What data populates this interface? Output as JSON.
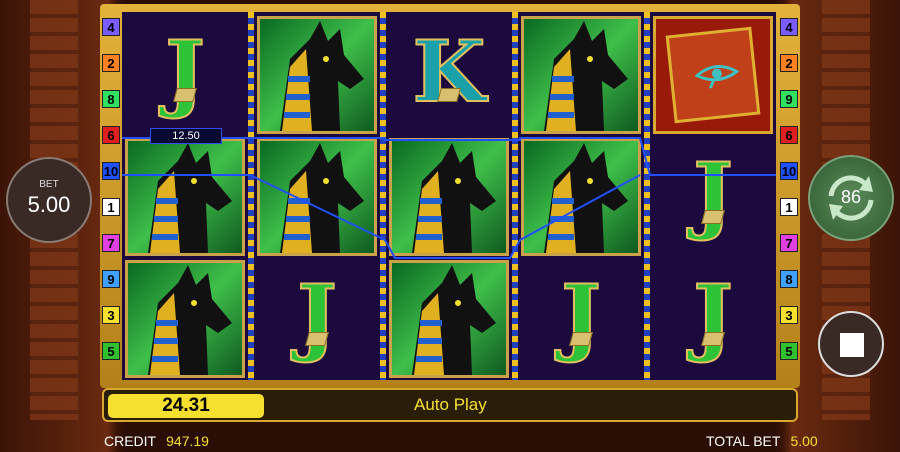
{
  "bet": {
    "label": "BET",
    "value": "5.00"
  },
  "autospin": {
    "count": "86"
  },
  "left_line_numbers": [
    "4",
    "2",
    "8",
    "6",
    "10",
    "1",
    "7",
    "9",
    "3",
    "5"
  ],
  "right_line_numbers": [
    "4",
    "2",
    "9",
    "6",
    "10",
    "1",
    "7",
    "8",
    "3",
    "5"
  ],
  "line_colors": [
    "#7a5cff",
    "#ff8020",
    "#30e060",
    "#e02020",
    "#2050ff",
    "#ffffff",
    "#e040e0",
    "#40a0ff",
    "#f5e030",
    "#30c030"
  ],
  "reels": [
    [
      "J",
      "anubis",
      "anubis"
    ],
    [
      "anubis",
      "anubis",
      "J"
    ],
    [
      "K",
      "anubis",
      "anubis"
    ],
    [
      "anubis",
      "anubis",
      "J"
    ],
    [
      "book",
      "J",
      "J"
    ]
  ],
  "win_label": "12.50",
  "last_win": "24.31",
  "auto_play_label": "Auto Play",
  "credit": {
    "label": "CREDIT",
    "value": "947.19"
  },
  "total_bet": {
    "label": "TOTAL BET",
    "value": "5.00"
  }
}
